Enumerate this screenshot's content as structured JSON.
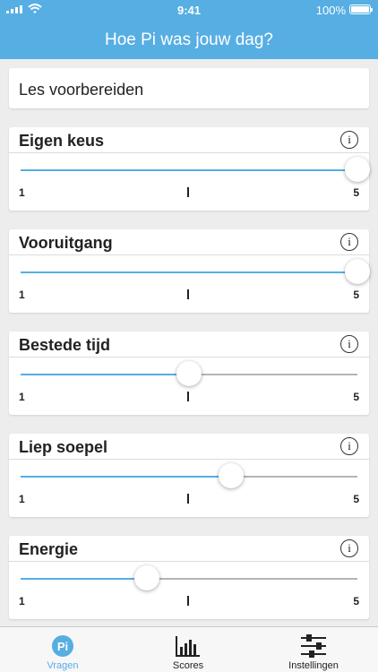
{
  "status_bar": {
    "time": "9:41",
    "battery": "100%"
  },
  "header": {
    "title": "Hoe Pi was jouw dag?"
  },
  "activity": {
    "value": "Les voorbereiden"
  },
  "questions": [
    {
      "label": "Eigen keus",
      "value": 5,
      "min_label": "1",
      "max_label": "5"
    },
    {
      "label": "Vooruitgang",
      "value": 5,
      "min_label": "1",
      "max_label": "5"
    },
    {
      "label": "Bestede tijd",
      "value": 3,
      "min_label": "1",
      "max_label": "5"
    },
    {
      "label": "Liep soepel",
      "value": 3.5,
      "min_label": "1",
      "max_label": "5"
    },
    {
      "label": "Energie",
      "value": 2.5,
      "min_label": "1",
      "max_label": "5"
    }
  ],
  "slider_scale": {
    "min": 1,
    "max": 5
  },
  "tabs": [
    {
      "label": "Vragen",
      "icon": "pi-icon",
      "active": true
    },
    {
      "label": "Scores",
      "icon": "bar-chart-icon",
      "active": false
    },
    {
      "label": "Instellingen",
      "icon": "sliders-icon",
      "active": false
    }
  ],
  "colors": {
    "accent": "#56aee3",
    "track": "#b5b5b5",
    "background": "#ededed"
  }
}
